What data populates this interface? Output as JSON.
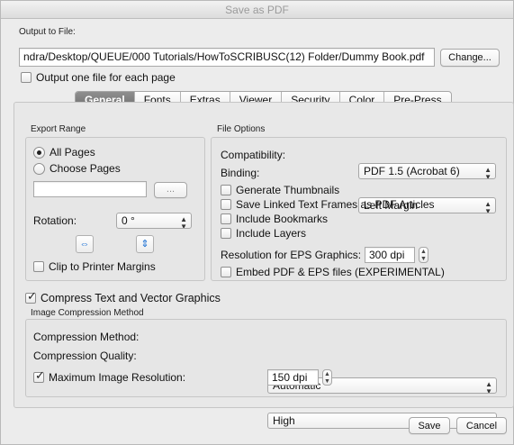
{
  "window": {
    "title": "Save as PDF"
  },
  "output": {
    "label": "Output to File:",
    "path": "ndra/Desktop/QUEUE/000 Tutorials/HowToSCRIBUSC(12) Folder/Dummy Book.pdf",
    "change_button": "Change...",
    "one_file_each_page": "Output one file for each page"
  },
  "tabs": [
    "General",
    "Fonts",
    "Extras",
    "Viewer",
    "Security",
    "Color",
    "Pre-Press"
  ],
  "export_range": {
    "title": "Export Range",
    "all_pages": "All Pages",
    "choose_pages": "Choose Pages",
    "pages_value": "",
    "browse_button": "...",
    "rotation_label": "Rotation:",
    "rotation_value": "0 °",
    "clip_margins": "Clip to Printer Margins"
  },
  "file_options": {
    "title": "File Options",
    "compatibility_label": "Compatibility:",
    "compatibility_value": "PDF 1.5 (Acrobat 6)",
    "binding_label": "Binding:",
    "binding_value": "Left Margin",
    "generate_thumbnails": "Generate Thumbnails",
    "save_linked_frames": "Save Linked Text Frames as PDF Articles",
    "include_bookmarks": "Include Bookmarks",
    "include_layers": "Include Layers",
    "eps_resolution_label": "Resolution for EPS Graphics:",
    "eps_resolution_value": "300 dpi",
    "embed_pdf_eps": "Embed PDF & EPS files (EXPERIMENTAL)"
  },
  "compress": {
    "label": "Compress Text and Vector Graphics",
    "image_method_title": "Image Compression Method",
    "method_label": "Compression Method:",
    "method_value": "Automatic",
    "quality_label": "Compression Quality:",
    "quality_value": "High",
    "max_res_label": "Maximum Image Resolution:",
    "max_res_value": "150 dpi"
  },
  "buttons": {
    "save": "Save",
    "cancel": "Cancel"
  },
  "icons": {
    "checkmark": "✓",
    "select_arrows": "⬍",
    "stepper": "▲▼"
  }
}
